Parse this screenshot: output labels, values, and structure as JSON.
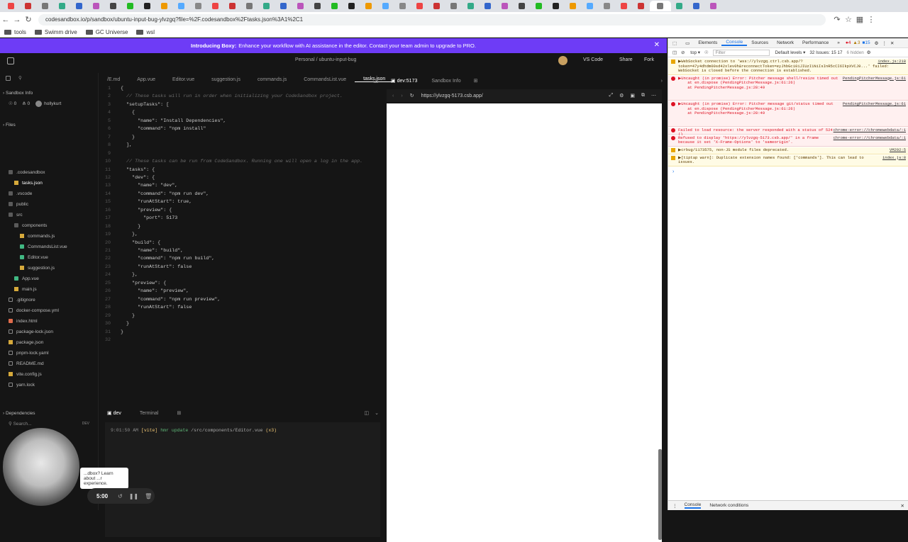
{
  "browser": {
    "url": "codesandbox.io/p/sandbox/ubuntu-input-bug-ylvzgq?file=%2F.codesandbox%2Ftasks.json%3A1%2C1",
    "bookmarks": [
      "tools",
      "Swimm drive",
      "GC Universe",
      "wsl"
    ]
  },
  "banner": {
    "bold": "Introducing Boxy:",
    "text": "Enhance your workflow with AI assistance in the editor.  Contact your team admin to upgrade to PRO."
  },
  "topbar": {
    "breadcrumb": "Personal / ubuntu-input-bug",
    "vscode": "VS Code",
    "share": "Share",
    "fork": "Fork"
  },
  "sidebar": {
    "sandbox_info": "Sandbox Info",
    "stats": {
      "views": "0",
      "forks": "0",
      "user": "hollykurt"
    },
    "files_header": "Files",
    "deps_header": "Dependencies",
    "search_placeholder": "Search...",
    "dev_badge": "DEV",
    "files": [
      {
        "name": ".codesandbox",
        "type": "folder",
        "depth": 1
      },
      {
        "name": "tasks.json",
        "type": "json",
        "depth": 2,
        "active": true
      },
      {
        "name": ".vscode",
        "type": "folder",
        "depth": 1
      },
      {
        "name": "public",
        "type": "folder",
        "depth": 1
      },
      {
        "name": "src",
        "type": "folder",
        "depth": 1
      },
      {
        "name": "components",
        "type": "folder",
        "depth": 2
      },
      {
        "name": "commands.js",
        "type": "js",
        "depth": 3
      },
      {
        "name": "CommandsList.vue",
        "type": "vue",
        "depth": 3
      },
      {
        "name": "Editor.vue",
        "type": "vue",
        "depth": 3
      },
      {
        "name": "suggestion.js",
        "type": "js",
        "depth": 3
      },
      {
        "name": "App.vue",
        "type": "vue",
        "depth": 2
      },
      {
        "name": "main.js",
        "type": "js",
        "depth": 2
      },
      {
        "name": ".gitignore",
        "type": "cfg",
        "depth": 1
      },
      {
        "name": "docker-compose.yml",
        "type": "cfg",
        "depth": 1
      },
      {
        "name": "index.html",
        "type": "html",
        "depth": 1
      },
      {
        "name": "package-lock.json",
        "type": "cfg",
        "depth": 1
      },
      {
        "name": "package.json",
        "type": "json",
        "depth": 1
      },
      {
        "name": "pnpm-lock.yaml",
        "type": "cfg",
        "depth": 1
      },
      {
        "name": "README.md",
        "type": "cfg",
        "depth": 1
      },
      {
        "name": "vite.config.js",
        "type": "js",
        "depth": 1
      },
      {
        "name": "yarn.lock",
        "type": "cfg",
        "depth": 1
      }
    ]
  },
  "editor_tabs": [
    "/E.md",
    "App.vue",
    "Editor.vue",
    "suggestion.js",
    "commands.js",
    "CommandsList.vue",
    "tasks.json"
  ],
  "active_tab": "tasks.json",
  "code": [
    "{",
    "  // These tasks will run in order when initializing your CodeSandbox project.",
    "  \"setupTasks\": [",
    "    {",
    "      \"name\": \"Install Dependencies\",",
    "      \"command\": \"npm install\"",
    "    }",
    "  ],",
    "",
    "  // These tasks can be run from CodeSandbox. Running one will open a log in the app.",
    "  \"tasks\": {",
    "    \"dev\": {",
    "      \"name\": \"dev\",",
    "      \"command\": \"npm run dev\",",
    "      \"runAtStart\": true,",
    "      \"preview\": {",
    "        \"port\": 5173",
    "      }",
    "    },",
    "    \"build\": {",
    "      \"name\": \"build\",",
    "      \"command\": \"npm run build\",",
    "      \"runAtStart\": false",
    "    },",
    "    \"preview\": {",
    "      \"name\": \"preview\",",
    "      \"command\": \"npm run preview\",",
    "      \"runAtStart\": false",
    "    }",
    "  }",
    "}",
    ""
  ],
  "terminal": {
    "tabs": [
      "dev",
      "Terminal"
    ],
    "line": {
      "time": "9:01:50 AM",
      "tag": "[vite]",
      "hmr": "hmr update",
      "path": "/src/components/Editor.vue",
      "count": "(x3)"
    }
  },
  "preview": {
    "tabs": [
      "dev:5173",
      "Sandbox Info"
    ],
    "url": "https://ylvzgq-5173.csb.app/"
  },
  "devtools": {
    "tabs": [
      "Elements",
      "Console",
      "Sources",
      "Network",
      "Performance"
    ],
    "active": "Console",
    "counts": {
      "errors": "4",
      "warnings": "3",
      "info": "15"
    },
    "context": "top",
    "filter_placeholder": "Filter",
    "levels": "Default levels",
    "issues": "32 Issues: 15 17",
    "hidden": "6 hidden",
    "messages": [
      {
        "type": "warn",
        "text": "▶WebSocket connection to 'wss://ylvzgq.ctrl.csb.app/?token=47y4dhdm00sd42xlev0h&reconnectToken=eyJhbGci0iJIUzI1NiIsInR5cCI6IkpXVCJ9...' failed: WebSocket is closed before the connection is established.",
        "src": "index.js:218"
      },
      {
        "type": "err",
        "text": "▶Uncaught (in promise) Error: Pitcher message shell/resize timed out\n    at en.dispose (PendingPitcherMessage.js:61:26)\n    at PendingPitcherMessage.js:28:49",
        "src": "PendingPitcherMessage.js:61"
      },
      {
        "type": "err",
        "text": "▶Uncaught (in promise) Error: Pitcher message git/status timed out\n    at en.dispose (PendingPitcherMessage.js:61:26)\n    at PendingPitcherMessage.js:28:49",
        "src": "PendingPitcherMessage.js:61"
      },
      {
        "type": "err",
        "text": "Failed to load resource: the server responded with a status of 524 ()",
        "src": "chrome-error://chromewebdata/:1"
      },
      {
        "type": "err",
        "text": "Refused to display 'https://ylvzgq-5173.csb.app/' in a frame because it set 'X-Frame-Options' to 'sameorigin'.",
        "src": "chrome-error://chromewebdata/:1"
      },
      {
        "type": "warn",
        "text": "▶crbug/1173575, non-JS module files deprecated.",
        "src": "VM292:5"
      },
      {
        "type": "warn",
        "text": "▶[tiptap warn]: Duplicate extension names found: ['commands']. This can lead to issues.",
        "src": "index.js:8"
      }
    ],
    "drawer_tabs": [
      "Console",
      "Network conditions"
    ]
  },
  "tooltip": "...dbox? Learn about ...r experience.",
  "timer": "5:00",
  "colors": {
    "banner": "#6e3cf6",
    "error": "#d12222",
    "warning": "#e8a600"
  }
}
